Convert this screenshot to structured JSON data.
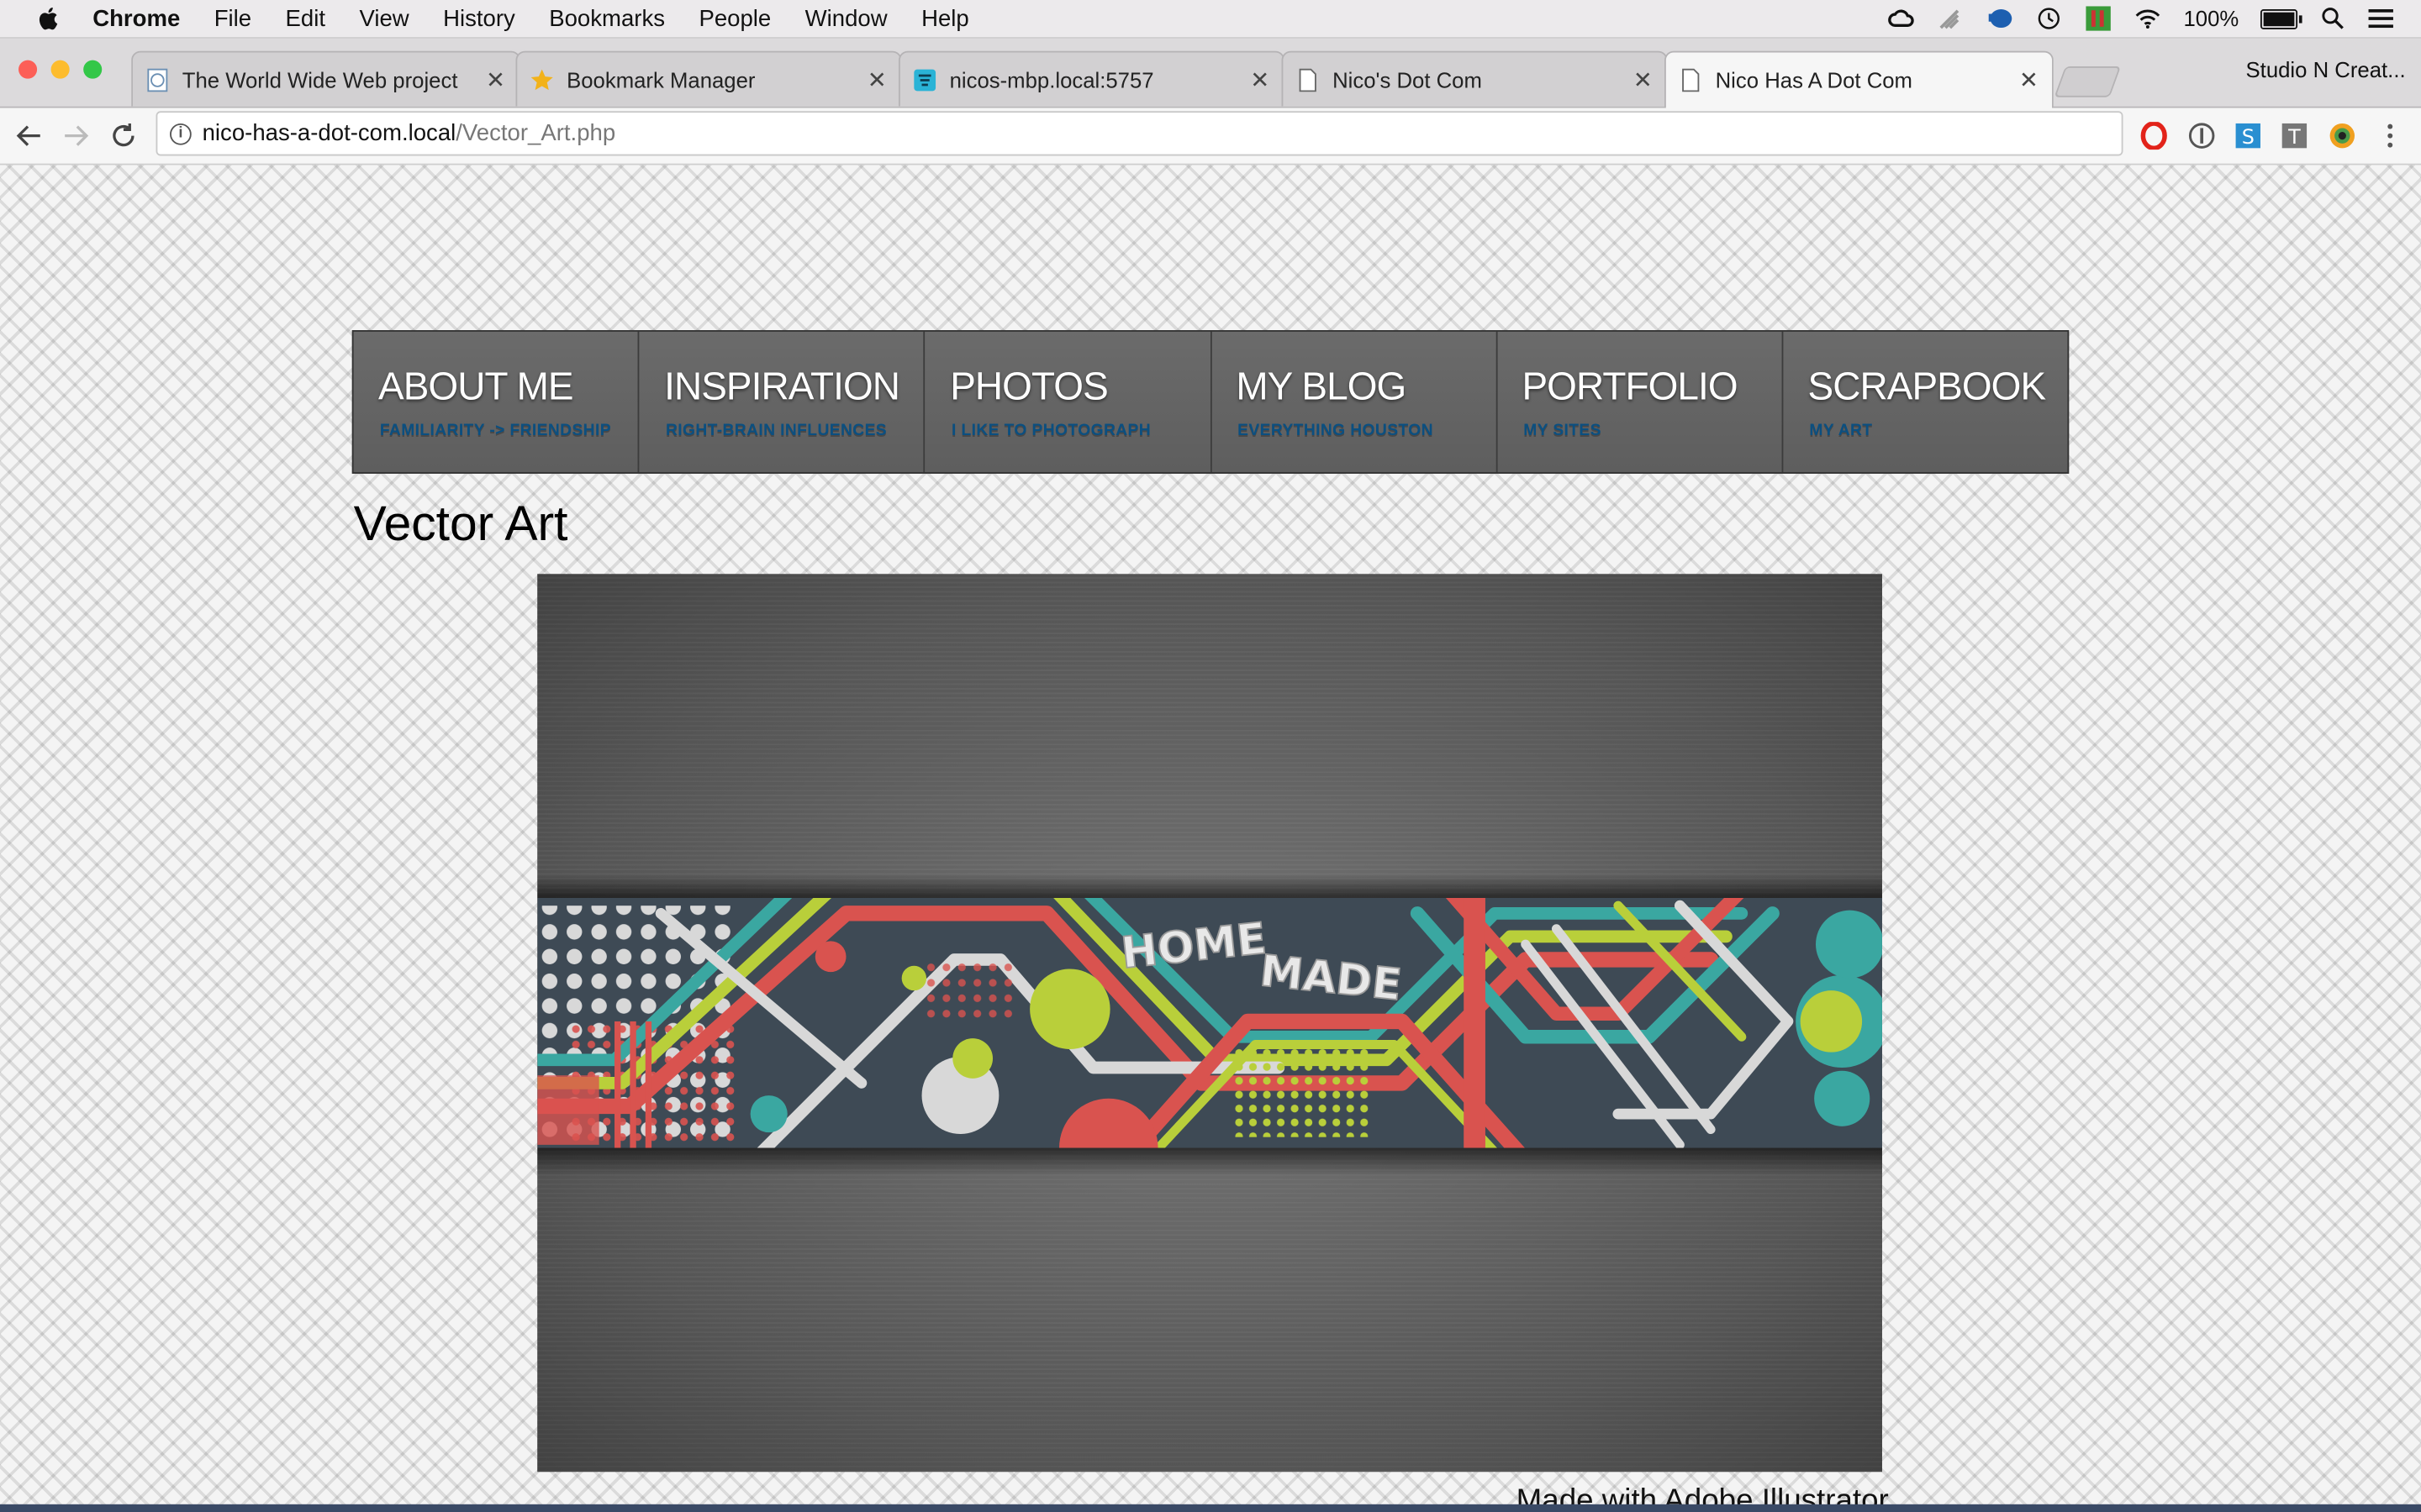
{
  "menubar": {
    "app": "Chrome",
    "items": [
      "File",
      "Edit",
      "View",
      "History",
      "Bookmarks",
      "People",
      "Window",
      "Help"
    ],
    "battery_text": "100%",
    "battery_level": 1.0
  },
  "tabs": [
    {
      "title": "The World Wide Web project",
      "icon": "globe-doc-icon",
      "active": false
    },
    {
      "title": "Bookmark Manager",
      "icon": "star-icon",
      "active": false
    },
    {
      "title": "nicos-mbp.local:5757",
      "icon": "site-icon",
      "active": false
    },
    {
      "title": "Nico's Dot Com",
      "icon": "page-icon",
      "active": false
    },
    {
      "title": "Nico Has A Dot Com",
      "icon": "page-icon",
      "active": true
    }
  ],
  "profile_label": "Studio N Creat...",
  "address": {
    "host": "nico-has-a-dot-com.local",
    "path": "/Vector_Art.php"
  },
  "nav": [
    {
      "title": "ABOUT ME",
      "subtitle": "FAMILIARITY -> FRIENDSHIP"
    },
    {
      "title": "INSPIRATION",
      "subtitle": "RIGHT-BRAIN INFLUENCES"
    },
    {
      "title": "PHOTOS",
      "subtitle": "I LIKE TO PHOTOGRAPH"
    },
    {
      "title": "MY BLOG",
      "subtitle": "EVERYTHING HOUSTON"
    },
    {
      "title": "PORTFOLIO",
      "subtitle": "MY SITES"
    },
    {
      "title": "SCRAPBOOK",
      "subtitle": "MY ART"
    }
  ],
  "page_title": "Vector Art",
  "artwork": {
    "text_line1": "HOME",
    "text_line2": "MADE"
  },
  "caption": "Made with Adobe Illustrator",
  "colors": {
    "traffic_red": "#fc5f57",
    "traffic_yellow": "#fdbc2e",
    "traffic_green": "#33c748",
    "nav_subtitle": "#0b4f80",
    "art_teal": "#3aa7a1",
    "art_red": "#d9534f",
    "art_lime": "#b9cf3a",
    "art_slate": "#3e4a55"
  }
}
